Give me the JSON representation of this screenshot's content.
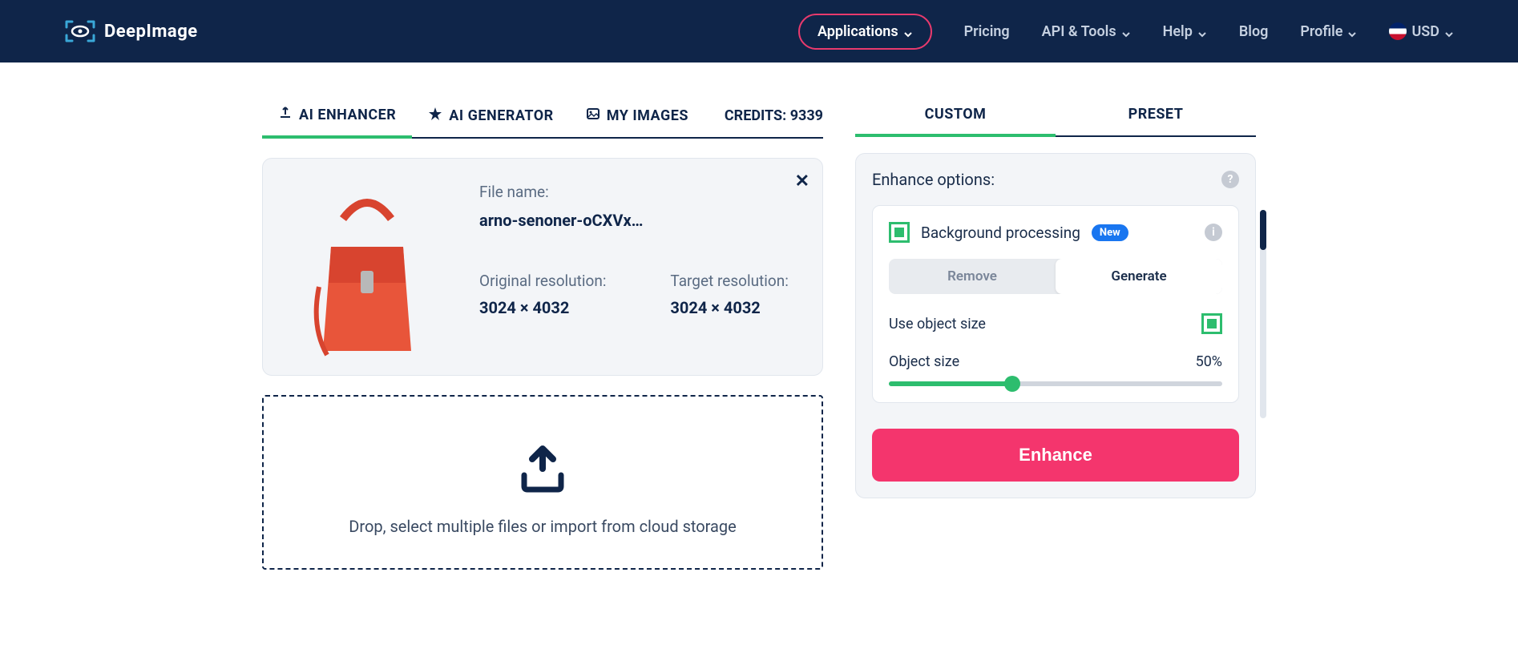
{
  "header": {
    "brand": "DeepImage",
    "nav": {
      "applications": "Applications",
      "pricing": "Pricing",
      "api": "API & Tools",
      "help": "Help",
      "blog": "Blog",
      "profile": "Profile",
      "currency": "USD"
    }
  },
  "tabs": {
    "enhancer": "AI ENHANCER",
    "generator": "AI GENERATOR",
    "myimages": "MY IMAGES",
    "credits_label": "CREDITS:",
    "credits_value": "9339"
  },
  "file": {
    "filename_label": "File name:",
    "filename": "arno-senoner-oCXVx…",
    "orig_label": "Original resolution:",
    "orig_value": "3024 × 4032",
    "target_label": "Target resolution:",
    "target_value": "3024 × 4032"
  },
  "dropzone": {
    "text": "Drop, select multiple files or import from cloud storage"
  },
  "panel": {
    "tab_custom": "CUSTOM",
    "tab_preset": "PRESET",
    "title": "Enhance options:",
    "bg_processing": "Background processing",
    "new_badge": "New",
    "seg_remove": "Remove",
    "seg_generate": "Generate",
    "use_object_size": "Use object size",
    "object_size_label": "Object size",
    "object_size_value": "50%",
    "object_size_pct": 37
  },
  "enhance_button": "Enhance"
}
